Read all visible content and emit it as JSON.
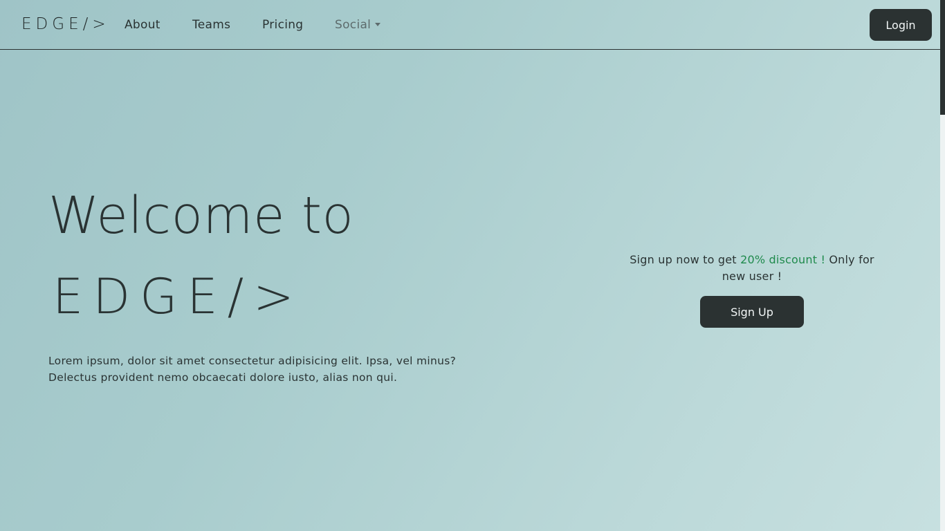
{
  "navbar": {
    "brand": "EDGE/>",
    "items": [
      {
        "label": "About"
      },
      {
        "label": "Teams"
      },
      {
        "label": "Pricing"
      },
      {
        "label": "Social"
      }
    ],
    "login_label": "Login"
  },
  "hero": {
    "title": "Welcome to",
    "logo": "EDGE/>",
    "text_line1": "Lorem ipsum, dolor sit amet consectetur adipisicing elit. Ipsa, vel minus?",
    "text_line2": "Delectus provident nemo obcaecati dolore iusto, alias non qui."
  },
  "promo": {
    "text_before": "Sign up now to get ",
    "highlight": "20% discount !",
    "text_after": " Only for new user !",
    "signup_label": "Sign Up",
    "highlight_color": "#1f8a4c",
    "button_color": "#2b3232"
  }
}
